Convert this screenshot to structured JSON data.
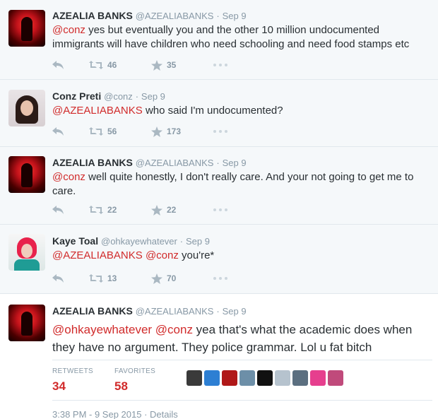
{
  "tweets": [
    {
      "fullname": "AZEALIA BANKS",
      "username": "@AZEALIABANKS",
      "dot": "·",
      "time": "Sep 9",
      "mention": "@conz",
      "text": " yes but eventually you and the other 10 million undocumented immigrants will have children who need schooling and need food stamps etc",
      "retweets": "46",
      "favorites": "35"
    },
    {
      "fullname": "Conz Preti",
      "username": "@conz",
      "dot": "·",
      "time": "Sep 9",
      "mention": "@AZEALIABANKS",
      "text": " who said I'm undocumented?",
      "retweets": "56",
      "favorites": "173"
    },
    {
      "fullname": "AZEALIA BANKS",
      "username": "@AZEALIABANKS",
      "dot": "·",
      "time": "Sep 9",
      "mention": "@conz",
      "text": " well quite honestly, I don't really care. And your not going to get me to care.",
      "retweets": "22",
      "favorites": "22"
    },
    {
      "fullname": "Kaye Toal",
      "username": "@ohkayewhatever",
      "dot": "·",
      "time": "Sep 9",
      "mention": "@AZEALIABANKS @conz",
      "text": " you're*",
      "retweets": "13",
      "favorites": "70"
    }
  ],
  "main_tweet": {
    "fullname": "AZEALIA BANKS",
    "username": "@AZEALIABANKS",
    "dot": "·",
    "time": "Sep 9",
    "mention": "@ohkayewhatever @conz",
    "text": " yea that's what the academic does when they have no argument. They police grammar. Lol u fat bitch",
    "retweets_label": "RETWEETS",
    "retweets": "34",
    "favorites_label": "FAVORITES",
    "favorites": "58",
    "timestamp": "3:38 PM - 9 Sep 2015 · Details"
  },
  "colors": {
    "mention": "#d12b2b",
    "muted": "#8899a6",
    "icon": "#aab8c2",
    "feed_bg": "#f5f8fa"
  },
  "favoriter_avatar_colors": [
    "#3a3a3a",
    "#2d7fd3",
    "#b01818",
    "#6d8fa8",
    "#111111",
    "#b6c3ce",
    "#5b6f80",
    "#e63f8e",
    "#c04a7b"
  ]
}
